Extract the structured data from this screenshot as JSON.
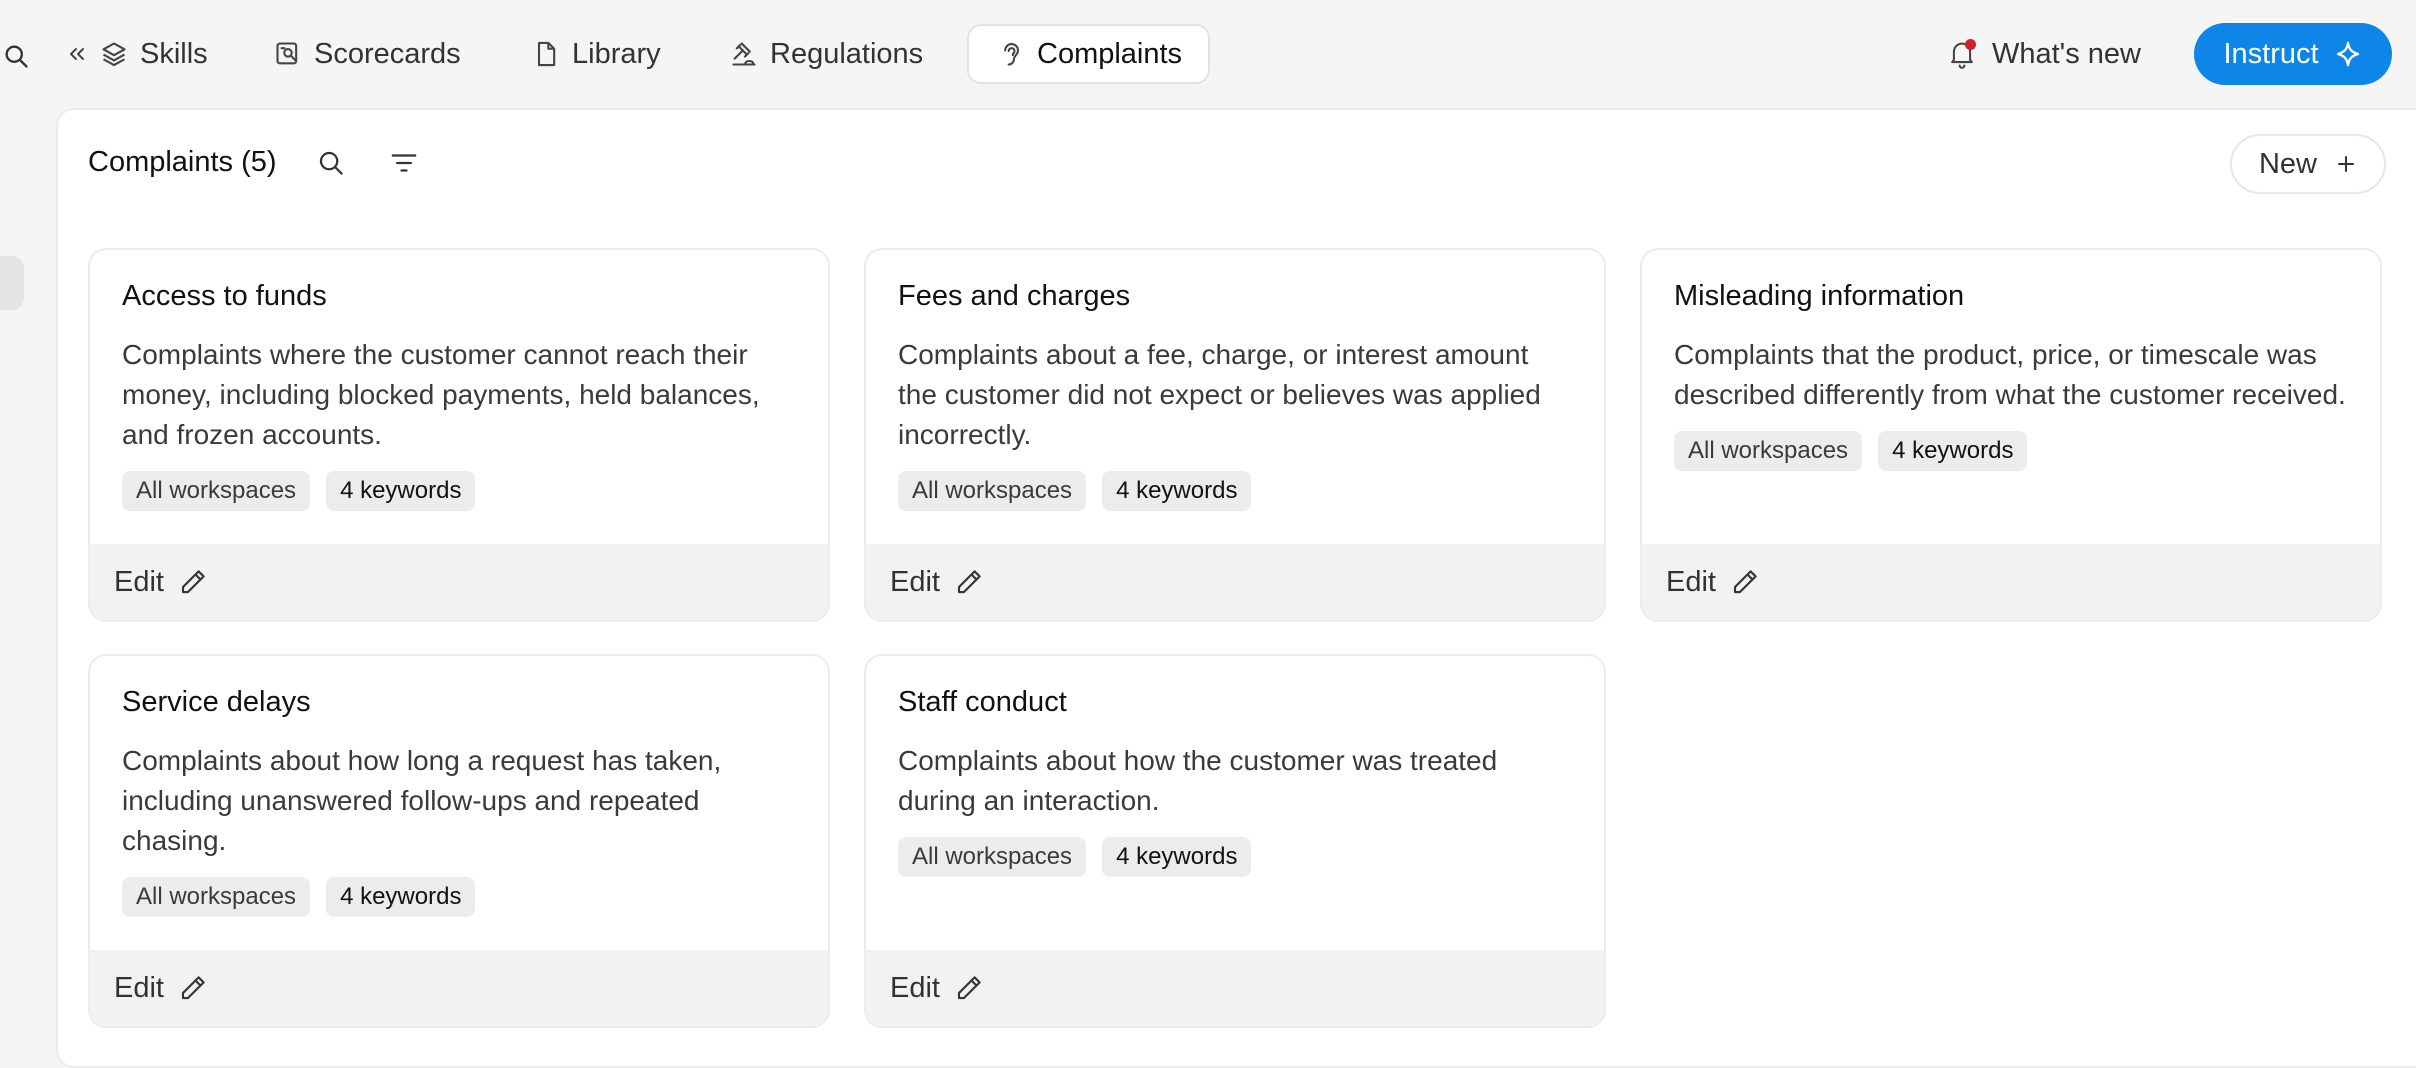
{
  "nav": {
    "tabs": [
      {
        "label": "Skills",
        "icon": "layers-icon"
      },
      {
        "label": "Scorecards",
        "icon": "scorecard-icon"
      },
      {
        "label": "Library",
        "icon": "document-icon"
      },
      {
        "label": "Regulations",
        "icon": "gavel-icon"
      },
      {
        "label": "Complaints",
        "icon": "ear-icon"
      }
    ],
    "active_tab": "Complaints",
    "whats_new_label": "What's new",
    "instruct_label": "Instruct"
  },
  "colors": {
    "accent": "#0e86e8",
    "notification_dot": "#d71f2b"
  },
  "page": {
    "title": "Complaints (5)",
    "new_label": "New"
  },
  "cards": [
    {
      "title": "Access to funds",
      "description": "Complaints where the customer cannot reach their money, including blocked payments, held balances, and frozen accounts.",
      "workspace_chip": "All workspaces",
      "keywords_chip": "4 keywords",
      "edit_label": "Edit"
    },
    {
      "title": "Fees and charges",
      "description": "Complaints about a fee, charge, or interest amount the customer did not expect or believes was applied incorrectly.",
      "workspace_chip": "All workspaces",
      "keywords_chip": "4 keywords",
      "edit_label": "Edit"
    },
    {
      "title": "Misleading information",
      "description": "Complaints that the product, price, or timescale was described differently from what the customer received.",
      "workspace_chip": "All workspaces",
      "keywords_chip": "4 keywords",
      "edit_label": "Edit"
    },
    {
      "title": "Service delays",
      "description": "Complaints about how long a request has taken, including unanswered follow-ups and repeated chasing.",
      "workspace_chip": "All workspaces",
      "keywords_chip": "4 keywords",
      "edit_label": "Edit"
    },
    {
      "title": "Staff conduct",
      "description": "Complaints about how the customer was treated during an interaction.",
      "workspace_chip": "All workspaces",
      "keywords_chip": "4 keywords",
      "edit_label": "Edit"
    }
  ]
}
